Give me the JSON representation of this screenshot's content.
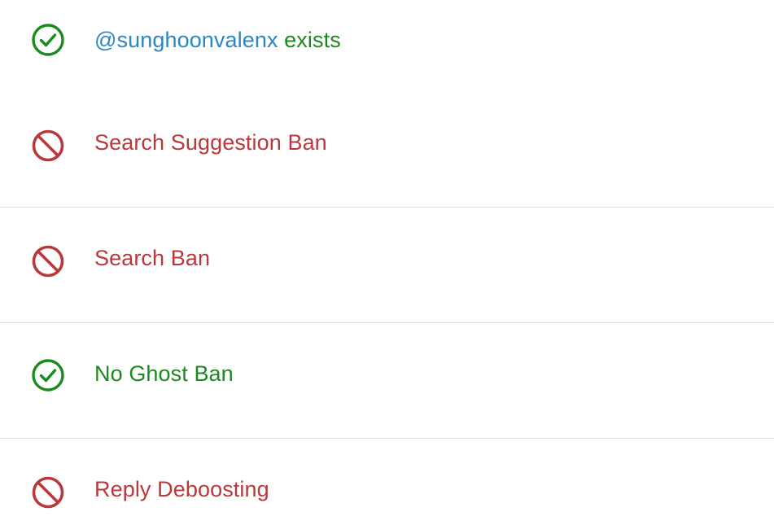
{
  "colors": {
    "ok": "#1a8a1f",
    "bad": "#b8383c",
    "handle": "#2b87c3",
    "divider": "#dbe2e8"
  },
  "results": [
    {
      "status": "ok",
      "icon": "check-circle-icon",
      "handle": "@sunghoonvalenx",
      "label": " exists"
    },
    {
      "status": "bad",
      "icon": "prohibited-icon",
      "label": "Search Suggestion Ban"
    },
    {
      "status": "bad",
      "icon": "prohibited-icon",
      "label": "Search Ban"
    },
    {
      "status": "ok",
      "icon": "check-circle-icon",
      "label": "No Ghost Ban"
    },
    {
      "status": "bad",
      "icon": "prohibited-icon",
      "label": "Reply Deboosting"
    }
  ]
}
